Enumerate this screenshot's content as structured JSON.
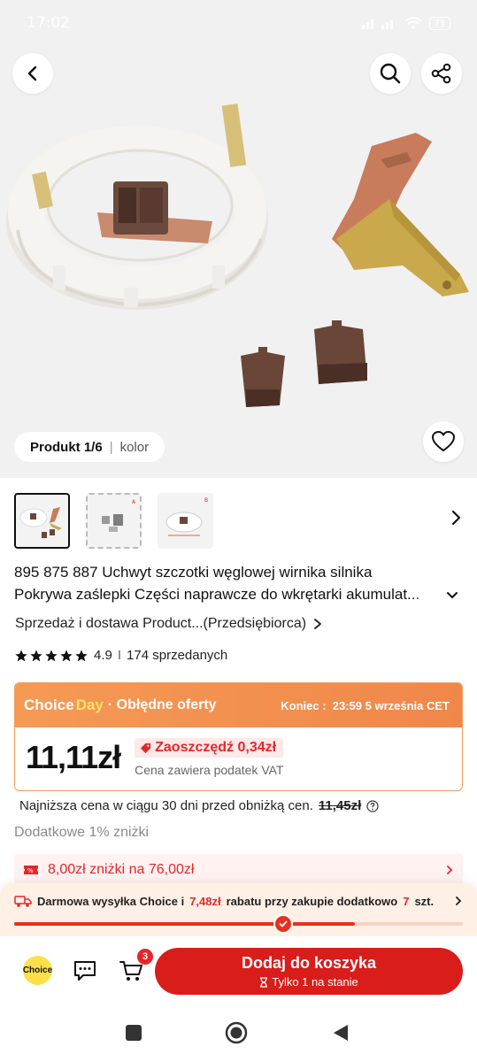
{
  "status_bar": {
    "time": "17:02",
    "battery": "71"
  },
  "gallery": {
    "counter": "Produkt 1/6",
    "separator": "|",
    "variant_label": "kolor"
  },
  "product": {
    "title_line1": "895 875 887 Uchwyt szczotki węglowej wirnika silnika",
    "title_line2": "Pokrywa zaślepki Części naprawcze do wkrętarki akumulat..."
  },
  "seller": {
    "text": "Sprzedaż i dostawa Product...(Przedsiębiorca)"
  },
  "rating": {
    "score": "4.9",
    "divider": "I",
    "sold": "174 sprzedanych",
    "stars": 5
  },
  "deal": {
    "brand_choice": "Choice",
    "brand_day": "Day",
    "deal_text": "· Obłędne oferty",
    "ends_label": "Koniec :",
    "ends_time": "23:59 5 września CET",
    "price": "11,11zł",
    "save": "Zaoszczędź 0,34zł",
    "vat_note": "Cena zawiera podatek VAT"
  },
  "lowest_price": {
    "text": "Najniższa cena w ciągu 30 dni przed obniżką cen.",
    "value": "11,45zł"
  },
  "extra_discount": "Dodatkowe 1% zniżki",
  "coupon": {
    "text": "8,00zł zniżki na 76,00zł"
  },
  "shipping": {
    "part1": "Darmowa wysyłka Choice i",
    "amount": "7,48zł",
    "part2": "rabatu przy zakupie dodatkowo",
    "count": "7",
    "part3": "szt.",
    "progress_fraction": 0.76
  },
  "bottom_bar": {
    "choice_badge": "Choice",
    "cart_count": "3",
    "add_to_cart": "Dodaj do koszyka",
    "stock_note": "Tylko 1 na stanie"
  },
  "colors": {
    "accent_red": "#d81d1b",
    "deal_orange": "#f0874a",
    "choice_yellow": "#fde047",
    "discount_red": "#e3272b"
  }
}
